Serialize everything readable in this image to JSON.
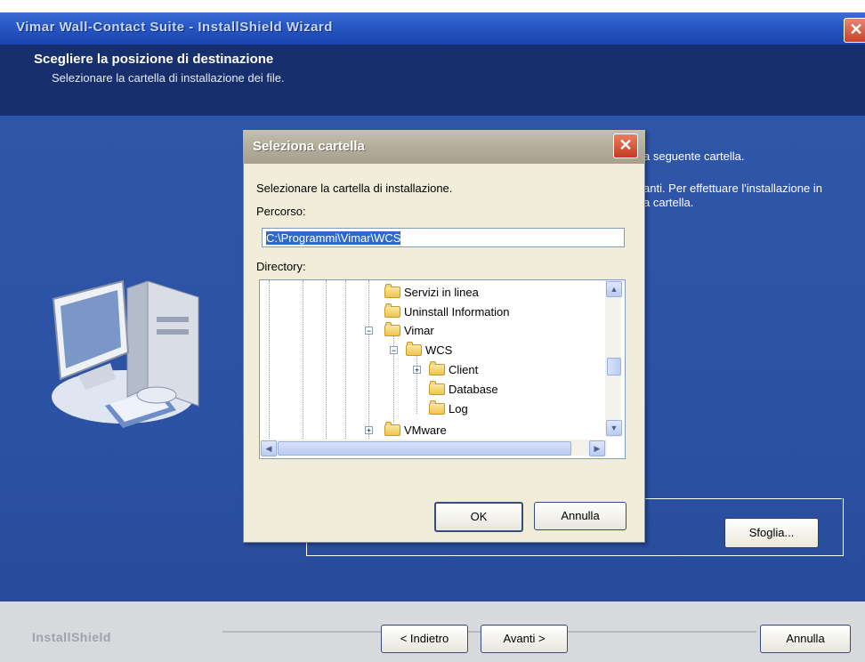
{
  "wizard": {
    "title": "Vimar Wall-Contact Suite - InstallShield Wizard",
    "header_title": "Scegliere la posizione di destinazione",
    "header_subtitle": "Selezionare la cartella di installazione dei file.",
    "body_line1": "a seguente cartella.",
    "body_line2": "anti. Per effettuare l'installazione in",
    "body_line3": "a cartella.",
    "browse_button": "Sfoglia...",
    "logo_bold": "InstallShield",
    "back_button": "< Indietro",
    "next_button": "Avanti >",
    "cancel_button": "Annulla"
  },
  "dialog": {
    "title": "Seleziona cartella",
    "prompt": "Selezionare la cartella di installazione.",
    "path_label": "Percorso:",
    "path_value": "C:\\Programmi\\Vimar\\WCS",
    "directory_label": "Directory:",
    "ok_button": "OK",
    "cancel_button": "Annulla",
    "tree": [
      {
        "label": "Servizi in linea"
      },
      {
        "label": "Uninstall Information"
      },
      {
        "label": "Vimar"
      },
      {
        "label": "WCS"
      },
      {
        "label": "Client"
      },
      {
        "label": "Database"
      },
      {
        "label": "Log"
      },
      {
        "label": "VMware"
      }
    ]
  },
  "colors": {
    "header_bg": "#182f6e",
    "body_bg": "#2b52a4",
    "dialog_bg": "#f0eed9",
    "selection": "#316ac5"
  }
}
